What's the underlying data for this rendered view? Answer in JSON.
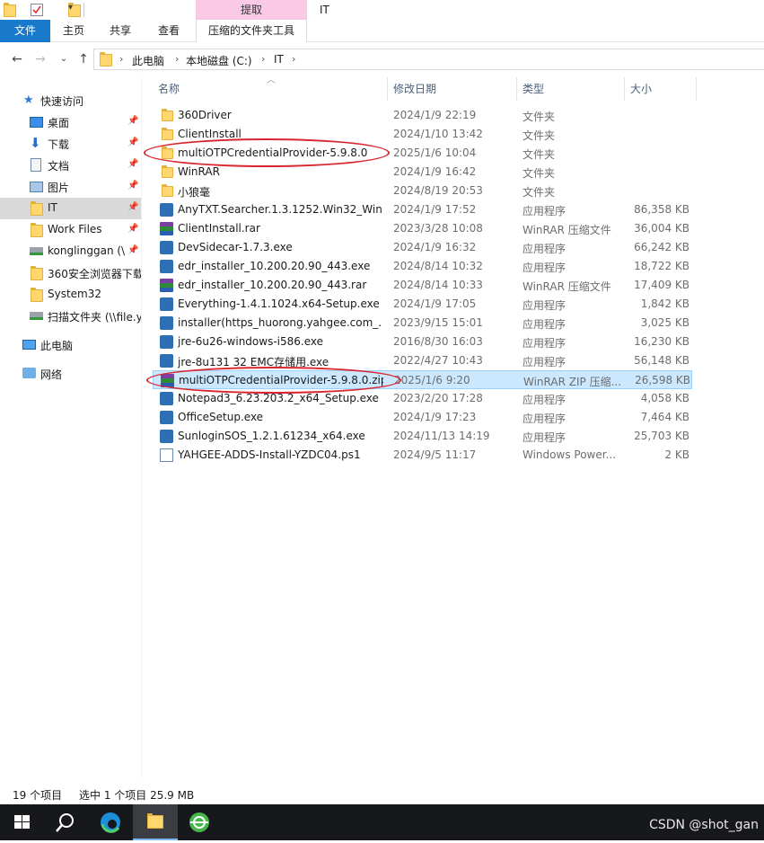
{
  "window": {
    "title": "IT",
    "context_group": "提取"
  },
  "ribbon": {
    "tabs": [
      "文件",
      "主页",
      "共享",
      "查看",
      "压缩的文件夹工具"
    ]
  },
  "address": {
    "crumbs": [
      "此电脑",
      "本地磁盘 (C:)",
      "IT"
    ]
  },
  "nav": {
    "quick_access": "快速访问",
    "items": [
      {
        "label": "桌面",
        "icon": "desktop-icon",
        "pinned": true
      },
      {
        "label": "下载",
        "icon": "download-icon",
        "pinned": true
      },
      {
        "label": "文档",
        "icon": "document-icon",
        "pinned": true
      },
      {
        "label": "图片",
        "icon": "picture-icon",
        "pinned": true
      },
      {
        "label": "IT",
        "icon": "folder-icon",
        "pinned": true,
        "selected": true
      },
      {
        "label": "Work Files",
        "icon": "folder-icon",
        "pinned": true
      },
      {
        "label": "konglinggan (\\\\",
        "icon": "network-drive-icon",
        "pinned": true
      },
      {
        "label": "360安全浏览器下载",
        "icon": "folder-icon",
        "pinned": false
      },
      {
        "label": "System32",
        "icon": "folder-icon",
        "pinned": false
      },
      {
        "label": "扫描文件夹 (\\\\file.y",
        "icon": "network-drive-icon",
        "pinned": false
      }
    ],
    "this_pc": "此电脑",
    "network": "网络"
  },
  "columns": [
    "名称",
    "修改日期",
    "类型",
    "大小"
  ],
  "files": [
    {
      "name": "360Driver",
      "date": "2024/1/9 22:19",
      "type": "文件夹",
      "size": "",
      "icon": "folder"
    },
    {
      "name": "ClientInstall",
      "date": "2024/1/10 13:42",
      "type": "文件夹",
      "size": "",
      "icon": "folder"
    },
    {
      "name": "multiOTPCredentialProvider-5.9.8.0",
      "date": "2025/1/6 10:04",
      "type": "文件夹",
      "size": "",
      "icon": "folder"
    },
    {
      "name": "WinRAR",
      "date": "2024/1/9 16:42",
      "type": "文件夹",
      "size": "",
      "icon": "folder"
    },
    {
      "name": "小狼毫",
      "date": "2024/8/19 20:53",
      "type": "文件夹",
      "size": "",
      "icon": "folder"
    },
    {
      "name": "AnyTXT.Searcher.1.3.1252.Win32_Win...",
      "date": "2024/1/9 17:52",
      "type": "应用程序",
      "size": "86,358 KB",
      "icon": "exe"
    },
    {
      "name": "ClientInstall.rar",
      "date": "2023/3/28 10:08",
      "type": "WinRAR 压缩文件",
      "size": "36,004 KB",
      "icon": "rar"
    },
    {
      "name": "DevSidecar-1.7.3.exe",
      "date": "2024/1/9 16:32",
      "type": "应用程序",
      "size": "66,242 KB",
      "icon": "exe"
    },
    {
      "name": "edr_installer_10.200.20.90_443.exe",
      "date": "2024/8/14 10:32",
      "type": "应用程序",
      "size": "18,722 KB",
      "icon": "exe"
    },
    {
      "name": "edr_installer_10.200.20.90_443.rar",
      "date": "2024/8/14 10:33",
      "type": "WinRAR 压缩文件",
      "size": "17,409 KB",
      "icon": "rar"
    },
    {
      "name": "Everything-1.4.1.1024.x64-Setup.exe",
      "date": "2024/1/9 17:05",
      "type": "应用程序",
      "size": "1,842 KB",
      "icon": "exe"
    },
    {
      "name": "installer(https_huorong.yahgee.com_...",
      "date": "2023/9/15 15:01",
      "type": "应用程序",
      "size": "3,025 KB",
      "icon": "exe"
    },
    {
      "name": "jre-6u26-windows-i586.exe",
      "date": "2016/8/30 16:03",
      "type": "应用程序",
      "size": "16,230 KB",
      "icon": "exe"
    },
    {
      "name": "jre-8u131 32 EMC存储用.exe",
      "date": "2022/4/27 10:43",
      "type": "应用程序",
      "size": "56,148 KB",
      "icon": "exe"
    },
    {
      "name": "multiOTPCredentialProvider-5.9.8.0.zip",
      "date": "2025/1/6 9:20",
      "type": "WinRAR ZIP 压缩...",
      "size": "26,598 KB",
      "icon": "rar",
      "selected": true
    },
    {
      "name": "Notepad3_6.23.203.2_x64_Setup.exe",
      "date": "2023/2/20 17:28",
      "type": "应用程序",
      "size": "4,058 KB",
      "icon": "exe"
    },
    {
      "name": "OfficeSetup.exe",
      "date": "2024/1/9 17:23",
      "type": "应用程序",
      "size": "7,464 KB",
      "icon": "exe"
    },
    {
      "name": "SunloginSOS_1.2.1.61234_x64.exe",
      "date": "2024/11/13 14:19",
      "type": "应用程序",
      "size": "25,703 KB",
      "icon": "exe"
    },
    {
      "name": "YAHGEE-ADDS-Install-YZDC04.ps1",
      "date": "2024/9/5 11:17",
      "type": "Windows Power...",
      "size": "2 KB",
      "icon": "script"
    }
  ],
  "status": {
    "count": "19 个项目",
    "selection": "选中 1 个项目  25.9 MB"
  },
  "watermark": "CSDN @shot_gan",
  "colors": {
    "accent": "#1979ca",
    "selection": "#cce8ff",
    "annotation": "#d8262f"
  }
}
